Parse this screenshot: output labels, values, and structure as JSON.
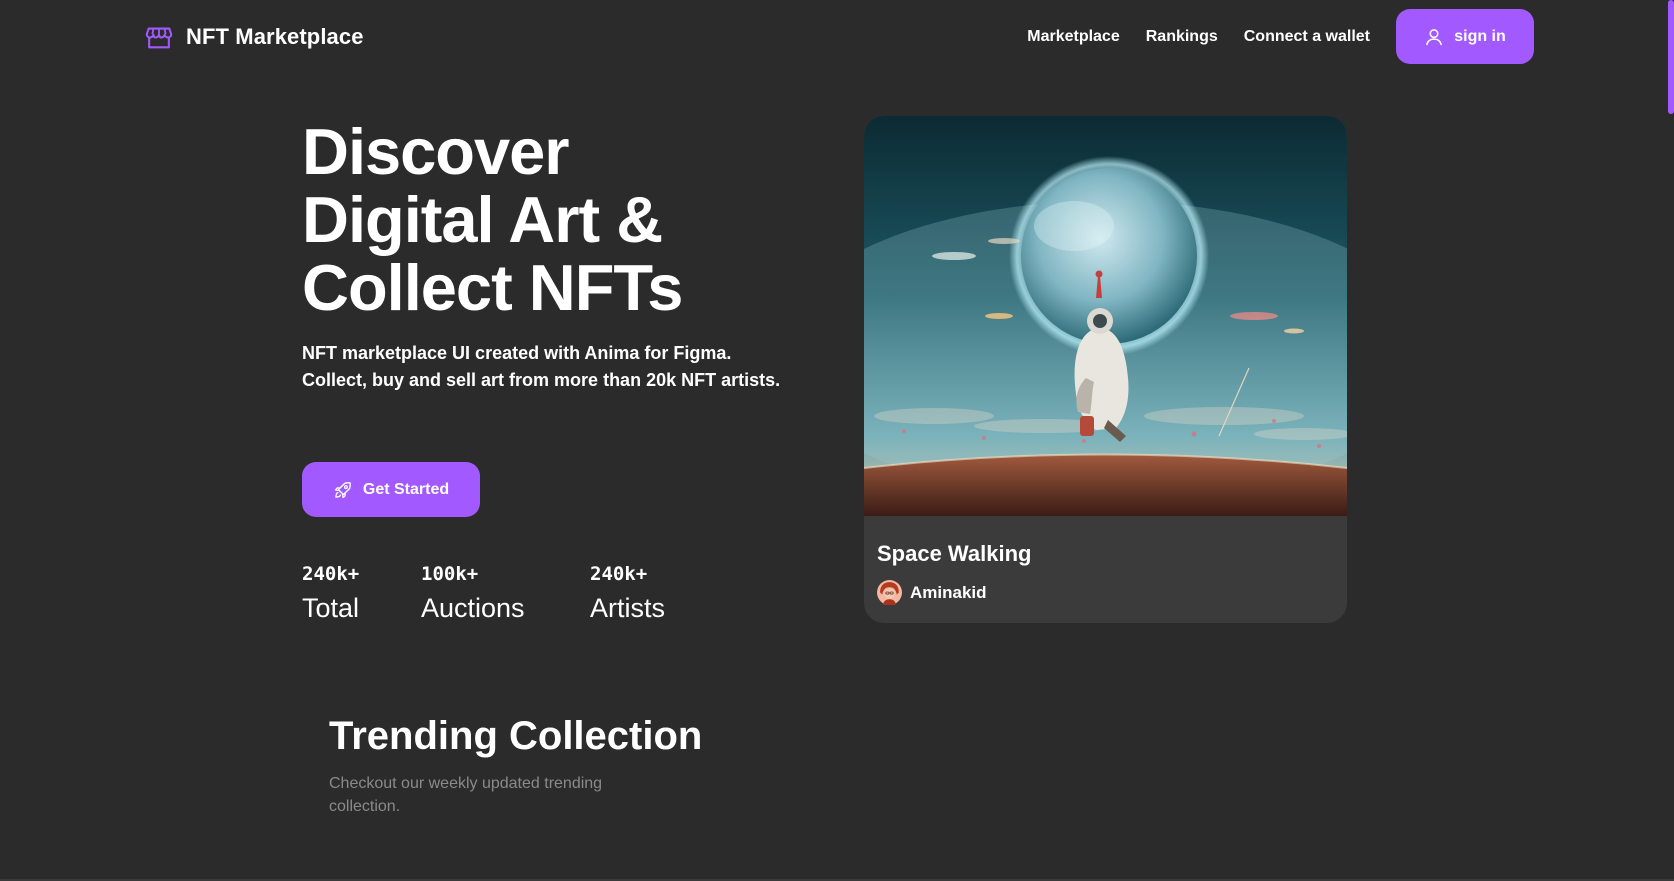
{
  "header": {
    "brand": {
      "name": "NFT Marketplace",
      "icon": "storefront-icon"
    },
    "nav": [
      {
        "label": "Marketplace"
      },
      {
        "label": "Rankings"
      },
      {
        "label": "Connect a wallet"
      }
    ],
    "signin": {
      "label": "sign in",
      "icon": "user-icon"
    }
  },
  "hero": {
    "title_lines": [
      "Discover",
      "Digital Art &",
      "Collect NFTs"
    ],
    "subtitle_lines": [
      "NFT marketplace UI created with Anima for Figma.",
      "Collect, buy and sell art from more than 20k NFT artists."
    ],
    "cta": {
      "label": "Get Started",
      "icon": "rocket-icon"
    },
    "stats": [
      {
        "value": "240k+",
        "label": "Total"
      },
      {
        "value": "100k+",
        "label": "Auctions"
      },
      {
        "value": "240k+",
        "label": "Artists"
      }
    ]
  },
  "featured_nft": {
    "title": "Space Walking",
    "artist": "Aminakid",
    "avatar_icon": "artist-avatar"
  },
  "trending": {
    "title": "Trending Collection",
    "subtitle_lines": [
      "Checkout our weekly updated trending",
      "collection."
    ]
  },
  "colors": {
    "background": "#2b2b2b",
    "accent": "#a259ff",
    "card": "#3b3b3b",
    "muted_text": "#8a8a8a"
  }
}
